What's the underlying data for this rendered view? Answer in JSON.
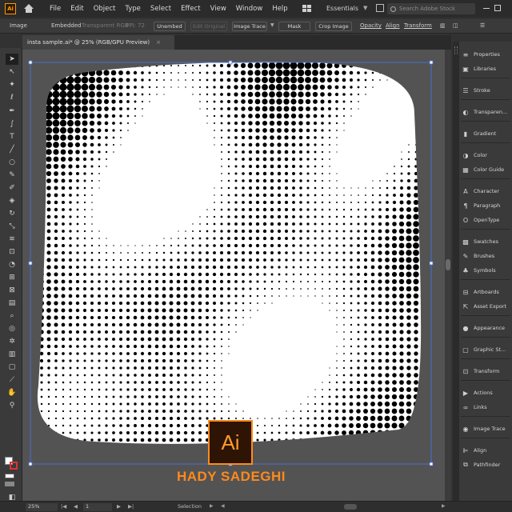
{
  "app": {
    "logo": "Ai",
    "menu": [
      "File",
      "Edit",
      "Object",
      "Type",
      "Select",
      "Effect",
      "View",
      "Window",
      "Help"
    ],
    "workspace": "Essentials",
    "search_placeholder": "Search Adobe Stock"
  },
  "control_bar": {
    "selection_type": "Image",
    "embedded": "Embedded",
    "color_mode": "Transparent RGB",
    "ppi": "PPI: 72",
    "unembed": "Unembed",
    "edit_original": "Edit Original",
    "image_trace": "Image Trace",
    "mask": "Mask",
    "crop_image": "Crop Image",
    "opacity": "Opacity",
    "align": "Align",
    "transform": "Transform"
  },
  "document": {
    "tab_title": "insta sample.ai* @ 25% (RGB/GPU Preview)",
    "close": "×"
  },
  "artwork": {
    "type": "halftone dot pattern (black dots on white, rounded squircle shape)",
    "watermark_logo": "Ai",
    "watermark_name": "HADY SADEGHI",
    "accent": "#ff8a1c",
    "selection_color": "#4a6fd0"
  },
  "right_panel": [
    {
      "label": "Properties",
      "icon": "properties-icon"
    },
    {
      "label": "Libraries",
      "icon": "libraries-icon"
    },
    {
      "label": "Stroke",
      "icon": "stroke-icon"
    },
    {
      "label": "Transparen...",
      "icon": "transparency-icon"
    },
    {
      "label": "Gradient",
      "icon": "gradient-icon"
    },
    {
      "label": "Color",
      "icon": "color-icon"
    },
    {
      "label": "Color Guide",
      "icon": "color-guide-icon"
    },
    {
      "label": "Character",
      "icon": "character-icon"
    },
    {
      "label": "Paragraph",
      "icon": "paragraph-icon"
    },
    {
      "label": "OpenType",
      "icon": "opentype-icon"
    },
    {
      "label": "Swatches",
      "icon": "swatches-icon"
    },
    {
      "label": "Brushes",
      "icon": "brushes-icon"
    },
    {
      "label": "Symbols",
      "icon": "symbols-icon"
    },
    {
      "label": "Artboards",
      "icon": "artboards-icon"
    },
    {
      "label": "Asset Export",
      "icon": "asset-export-icon"
    },
    {
      "label": "Appearance",
      "icon": "appearance-icon"
    },
    {
      "label": "Graphic St...",
      "icon": "graphic-styles-icon"
    },
    {
      "label": "Transform",
      "icon": "transform-icon"
    },
    {
      "label": "Actions",
      "icon": "actions-icon"
    },
    {
      "label": "Links",
      "icon": "links-icon"
    },
    {
      "label": "Image Trace",
      "icon": "image-trace-icon"
    },
    {
      "label": "Align",
      "icon": "align-icon"
    },
    {
      "label": "Pathfinder",
      "icon": "pathfinder-icon"
    }
  ],
  "status_bar": {
    "zoom": "25%",
    "artboard": "1",
    "tool_status": "Selection"
  }
}
